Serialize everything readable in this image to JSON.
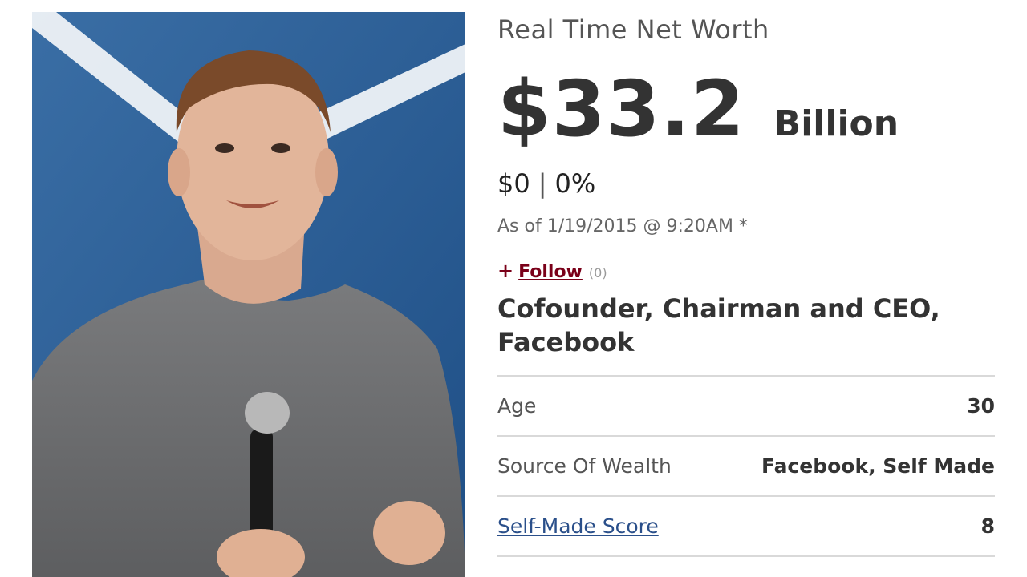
{
  "header": {
    "section_title": "Real Time Net Worth"
  },
  "net_worth": {
    "amount": "$33.2",
    "unit": "Billion"
  },
  "change": {
    "dollar": "$0",
    "separator": "|",
    "percent": "0%"
  },
  "as_of": "As of 1/19/2015 @ 9:20AM *",
  "follow": {
    "plus": "+",
    "label": "Follow",
    "count": "(0)"
  },
  "title": "Cofounder, Chairman and CEO, Facebook",
  "stats": [
    {
      "label": "Age",
      "value": "30"
    },
    {
      "label": "Source Of Wealth",
      "value": "Facebook, Self Made"
    },
    {
      "label": "Self-Made Score",
      "value": "8"
    }
  ],
  "colors": {
    "follow_accent": "#7a0019",
    "link_blue": "#2a4f8a",
    "divider": "#d9d9d9"
  }
}
